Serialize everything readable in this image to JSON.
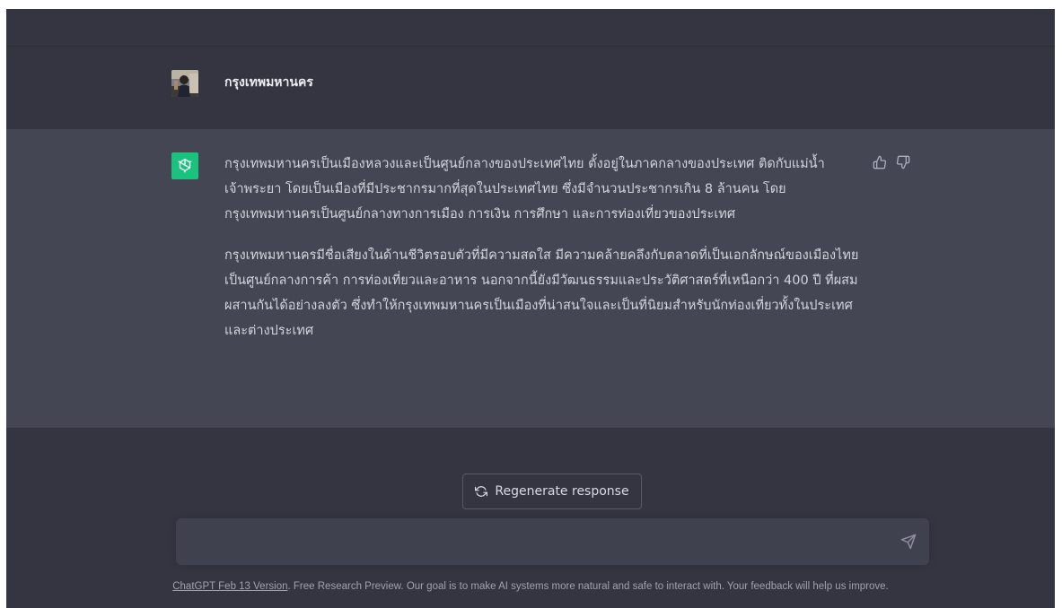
{
  "conversation": {
    "user_message": "กรุงเทพมหานคร",
    "assistant_paragraphs": [
      "กรุงเทพมหานครเป็นเมืองหลวงและเป็นศูนย์กลางของประเทศไทย ตั้งอยู่ในภาคกลางของประเทศ ติดกับแม่น้ำเจ้าพระยา โดยเป็นเมืองที่มีประชากรมากที่สุดในประเทศไทย ซึ่งมีจำนวนประชากรเกิน 8 ล้านคน โดยกรุงเทพมหานครเป็นศูนย์กลางทางการเมือง การเงิน การศึกษา และการท่องเที่ยวของประเทศ",
      "กรุงเทพมหานครมีชื่อเสียงในด้านชีวิตรอบตัวที่มีความสดใส มีความคล้ายคลึงกับตลาดที่เป็นเอกลักษณ์ของเมืองไทย เป็นศูนย์กลางการค้า การท่องเที่ยวและอาหาร นอกจากนี้ยังมีวัฒนธรรมและประวัติศาสตร์ที่เหนือกว่า 400 ปี ที่ผสมผสานกันได้อย่างลงตัว ซึ่งทำให้กรุงเทพมหานครเป็นเมืองที่น่าสนใจและเป็นที่นิยมสำหรับนักท่องเที่ยวทั้งในประเทศและต่างประเทศ"
    ],
    "feedback_icons": [
      "thumbs-up-icon",
      "thumbs-down-icon"
    ]
  },
  "regenerate": {
    "label": "Regenerate response",
    "icon": "refresh-icon"
  },
  "composer": {
    "placeholder": "",
    "send_icon": "send-icon"
  },
  "footer": {
    "link_text": "ChatGPT Feb 13 Version",
    "text": ". Free Research Preview. Our goal is to make AI systems more natural and safe to interact with. Your feedback will help us improve."
  },
  "colors": {
    "background": "#343541",
    "assistant_background": "#444654",
    "brand_green": "#19c37d",
    "input_background": "#40414f"
  }
}
